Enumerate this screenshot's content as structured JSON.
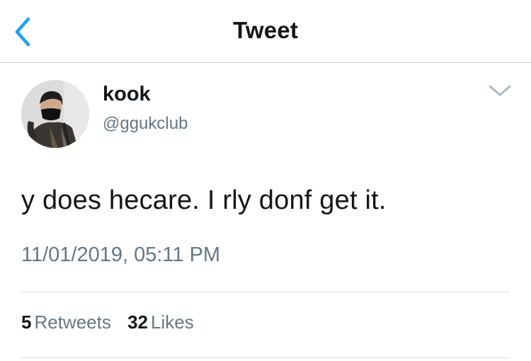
{
  "nav": {
    "title": "Tweet",
    "back_icon": "chevron-left-icon",
    "accent_color": "#1da1f2"
  },
  "tweet": {
    "author": {
      "display_name": "kook",
      "handle": "@ggukclub"
    },
    "text": "y does hecare. I rly donf get it.",
    "timestamp": "11/01/2019, 05:11 PM",
    "menu_icon": "chevron-down-icon",
    "stats": {
      "retweets": {
        "count": "5",
        "label": "Retweets"
      },
      "likes": {
        "count": "32",
        "label": "Likes"
      }
    }
  },
  "colors": {
    "text_primary": "#14171a",
    "text_secondary": "#657786",
    "divider": "#d8dde2"
  }
}
